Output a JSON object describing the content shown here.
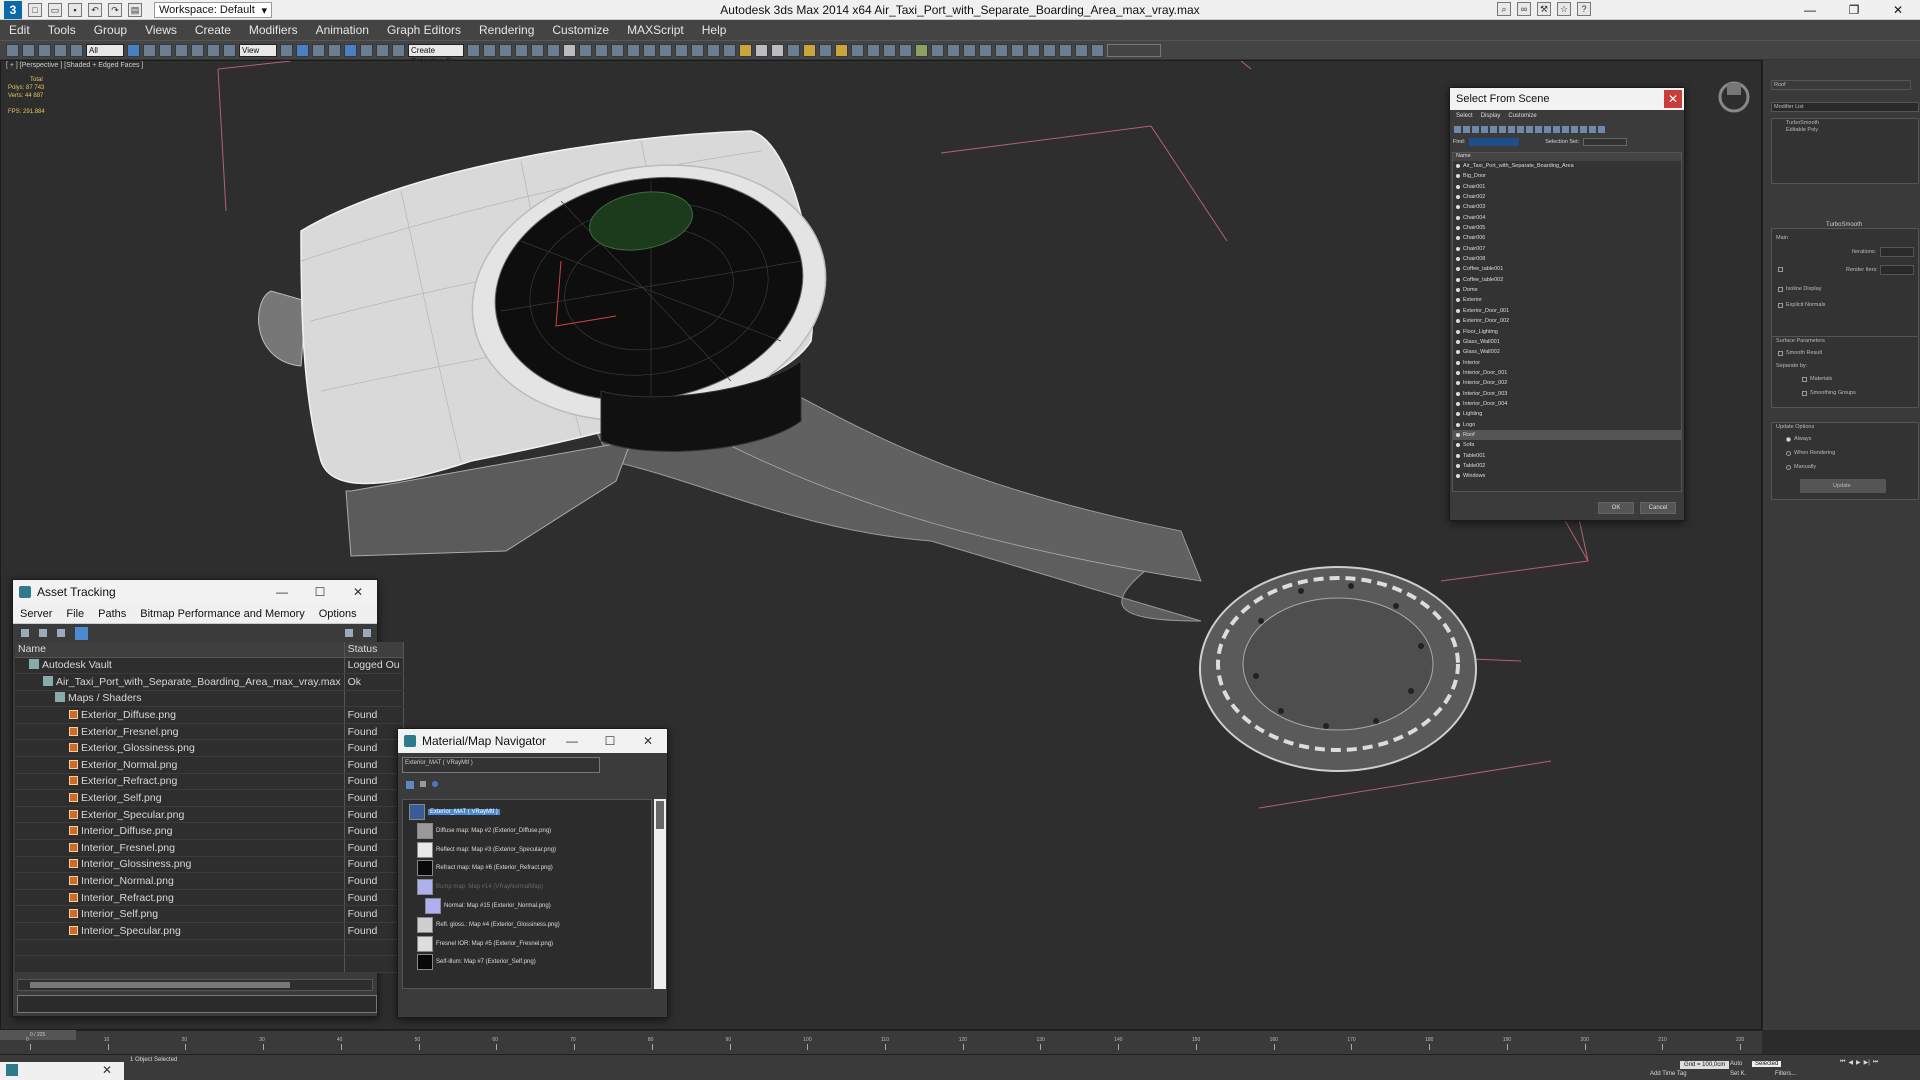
{
  "titlebar": {
    "workspace": "Workspace: Default",
    "title": "Autodesk 3ds Max  2014 x64     Air_Taxi_Port_with_Separate_Boarding_Area_max_vray.max",
    "minimize": "—",
    "maximize": "❐",
    "close": "✕"
  },
  "menu": [
    "Edit",
    "Tools",
    "Group",
    "Views",
    "Create",
    "Modifiers",
    "Animation",
    "Graph Editors",
    "Rendering",
    "Customize",
    "MAXScript",
    "Help"
  ],
  "toolbar": {
    "selection_filter": "All",
    "ref_coord": "View",
    "named_sel": "Create Selection Se"
  },
  "viewport": {
    "label": "[ + ] [Perspective ] [Shaded + Edged Faces ]",
    "stats": {
      "total_label": "Total",
      "polys_label": "Polys:",
      "polys": "87 743",
      "verts_label": "Verts:",
      "verts": "44 887",
      "fps_label": "FPS:",
      "fps": "291.884"
    }
  },
  "asset_tracking": {
    "title": "Asset Tracking",
    "menu": [
      "Server",
      "File",
      "Paths",
      "Bitmap Performance and Memory",
      "Options"
    ],
    "columns": [
      "Name",
      "Status"
    ],
    "rows": [
      {
        "name": "Autodesk Vault",
        "status": "Logged Ou"
      },
      {
        "name": "Air_Taxi_Port_with_Separate_Boarding_Area_max_vray.max",
        "status": "Ok"
      },
      {
        "name": "Maps / Shaders",
        "status": ""
      },
      {
        "name": "Exterior_Diffuse.png",
        "status": "Found"
      },
      {
        "name": "Exterior_Fresnel.png",
        "status": "Found"
      },
      {
        "name": "Exterior_Glossiness.png",
        "status": "Found"
      },
      {
        "name": "Exterior_Normal.png",
        "status": "Found"
      },
      {
        "name": "Exterior_Refract.png",
        "status": "Found"
      },
      {
        "name": "Exterior_Self.png",
        "status": "Found"
      },
      {
        "name": "Exterior_Specular.png",
        "status": "Found"
      },
      {
        "name": "Interior_Diffuse.png",
        "status": "Found"
      },
      {
        "name": "Interior_Fresnel.png",
        "status": "Found"
      },
      {
        "name": "Interior_Glossiness.png",
        "status": "Found"
      },
      {
        "name": "Interior_Normal.png",
        "status": "Found"
      },
      {
        "name": "Interior_Refract.png",
        "status": "Found"
      },
      {
        "name": "Interior_Self.png",
        "status": "Found"
      },
      {
        "name": "Interior_Specular.png",
        "status": "Found"
      }
    ]
  },
  "material_navigator": {
    "title": "Material/Map Navigator",
    "field": "Exterior_MAT ( VRayMtl )",
    "items": [
      "Exterior_MAT ( VRayMtl )",
      "Diffuse map: Map #2 (Exterior_Diffuse.png)",
      "Reflect map: Map #3 (Exterior_Specular.png)",
      "Refract map: Map #6 (Exterior_Refract.png)",
      "Bump map: Map #14 (VRayNormalMap)",
      "Normal: Map #15 (Exterior_Normal.png)",
      "Refl. gloss.: Map #4 (Exterior_Glossiness.png)",
      "Fresnel IOR: Map #5 (Exterior_Fresnel.png)",
      "Self-illum: Map #7 (Exterior_Self.png)"
    ]
  },
  "select_from_scene": {
    "title": "Select From Scene",
    "menu": [
      "Select",
      "Display",
      "Customize"
    ],
    "find_label": "Find:",
    "selection_set_label": "Selection Set:",
    "list_header": "Name",
    "items": [
      "Air_Taxi_Port_with_Separate_Boarding_Area",
      "Big_Door",
      "Chair001",
      "Chair002",
      "Chair003",
      "Chair004",
      "Chair005",
      "Chair006",
      "Chair007",
      "Chair008",
      "Coffee_table001",
      "Coffee_table002",
      "Dome",
      "Exterior",
      "Exterior_Door_001",
      "Exterior_Door_002",
      "Floor_Lighting",
      "Glass_Wall001",
      "Glass_Wall002",
      "Interior",
      "Interior_Door_001",
      "Interior_Door_002",
      "Interior_Door_003",
      "Interior_Door_004",
      "Lighting",
      "Logo",
      "Roof",
      "Sofa",
      "Table001",
      "Table002",
      "Windows"
    ],
    "selected": "Roof",
    "ok": "OK",
    "cancel": "Cancel"
  },
  "command_panel": {
    "object_name": "Roof",
    "modifier_list": "Modifier List",
    "stack": [
      "TurboSmooth",
      "Editable Poly"
    ],
    "rollout": "TurboSmooth",
    "main": "Main",
    "iterations": "Iterations:",
    "render_iters": "Render Iters:",
    "isoline": "Isoline Display",
    "explicit": "Explicit Normals",
    "surface_params": "Surface Parameters",
    "smooth_result": "Smooth Result",
    "separate_by": "Separate by:",
    "materials": "Materials",
    "smoothing_groups": "Smoothing Groups",
    "update_options": "Update Options",
    "always": "Always",
    "when_rendering": "When Rendering",
    "manually": "Manually",
    "update": "Update"
  },
  "timeline": {
    "frame": "0 / 225",
    "ticks": [
      "0",
      "10",
      "20",
      "30",
      "40",
      "50",
      "60",
      "70",
      "80",
      "90",
      "100",
      "110",
      "120",
      "130",
      "140",
      "150",
      "160",
      "170",
      "180",
      "190",
      "200",
      "210",
      "220"
    ]
  },
  "status": {
    "objects": "1 Object Selected",
    "selected": "Selected",
    "grid": "Grid = 100,0cm",
    "add_time_tag": "Add Time Tag",
    "auto": "Auto",
    "set_k": "Set K.",
    "filters": "Filters..."
  },
  "colors": {
    "accent": "#4a8ad0",
    "viewport_bg": "#2e2e2e",
    "found_icon": "#d06a28"
  }
}
